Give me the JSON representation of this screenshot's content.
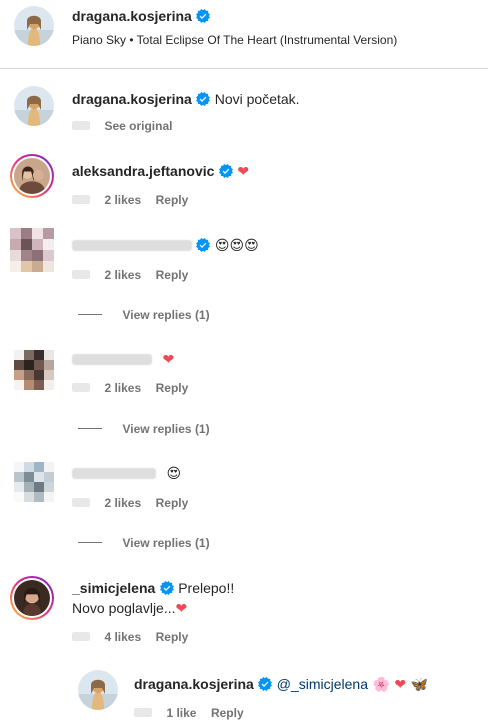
{
  "caption": {
    "username": "dragana.kosjerina",
    "music": "Piano Sky • Total Eclipse Of The Heart (Instrumental Version)"
  },
  "comments": [
    {
      "username": "dragana.kosjerina",
      "text": "Novi početak.",
      "see_original": "See original"
    },
    {
      "username": "aleksandra.jeftanovic",
      "emoji": "❤",
      "likes": "2 likes",
      "reply": "Reply"
    },
    {
      "emoji": "😍😍😍",
      "likes": "2 likes",
      "reply": "Reply",
      "view_replies": "View replies (1)"
    },
    {
      "emoji": "❤",
      "likes": "2 likes",
      "reply": "Reply",
      "view_replies": "View replies (1)"
    },
    {
      "emoji": "😍",
      "likes": "2 likes",
      "reply": "Reply",
      "view_replies": "View replies (1)"
    },
    {
      "username": "_simicjelena",
      "text_line1": "Prelepo!!",
      "text_line2": "Novo poglavlje...",
      "emoji": "❤",
      "likes": "4 likes",
      "reply": "Reply"
    }
  ],
  "nested_reply": {
    "username": "dragana.kosjerina",
    "mention": "@_simicjelena",
    "emoji_flower": "🌸",
    "emoji_heart": "❤",
    "emoji_butterfly": "🦋",
    "likes": "1 like",
    "reply": "Reply"
  },
  "colors": {
    "verified": "#0095f6",
    "heart": "#ed4956",
    "muted": "#737373",
    "mention": "#00376b"
  }
}
